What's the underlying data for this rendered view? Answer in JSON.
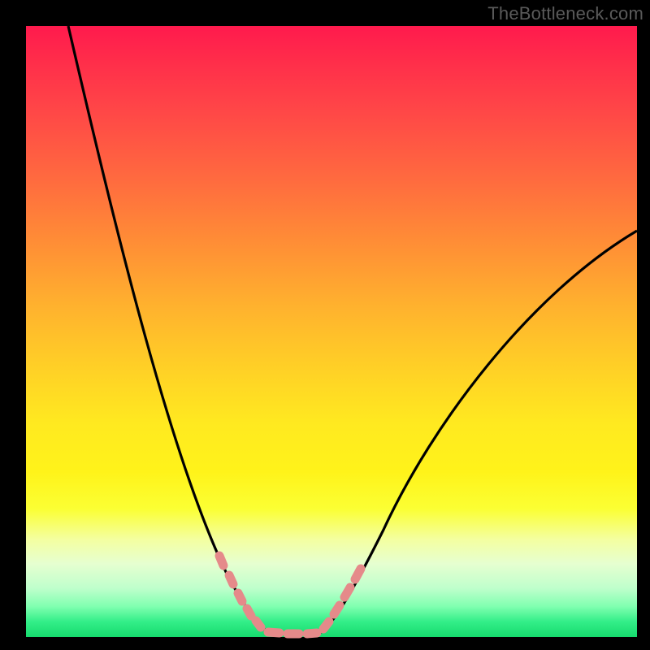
{
  "watermark": "TheBottleneck.com",
  "colors": {
    "frame_background": "#000000",
    "curve_stroke": "#000000",
    "highlight_stroke": "#e58a8a",
    "gradient_top": "#ff1a4d",
    "gradient_mid": "#ffe920",
    "gradient_bottom": "#16db6e"
  },
  "chart_data": {
    "type": "line",
    "title": "",
    "xlabel": "",
    "ylabel": "",
    "xlim": [
      0,
      100
    ],
    "ylim": [
      0,
      100
    ],
    "grid": false,
    "legend": false,
    "background": "vertical red→yellow→green gradient (red = high bottleneck, green = low)",
    "series": [
      {
        "name": "bottleneck-curve",
        "stroke": "#000000",
        "x": [
          7,
          12,
          17,
          22,
          27,
          32,
          36,
          40,
          44,
          48,
          52,
          58,
          65,
          75,
          88,
          100
        ],
        "values": [
          100,
          78,
          58,
          41,
          27,
          15,
          7,
          2,
          0,
          0,
          3,
          10,
          22,
          40,
          58,
          67
        ]
      }
    ],
    "annotations": [
      {
        "name": "optimal-range-highlight",
        "type": "marker-segment",
        "stroke": "#e58a8a",
        "x_range": [
          32,
          55
        ],
        "note": "thick salmon tick marks along the curve near its minimum / green band"
      }
    ]
  }
}
